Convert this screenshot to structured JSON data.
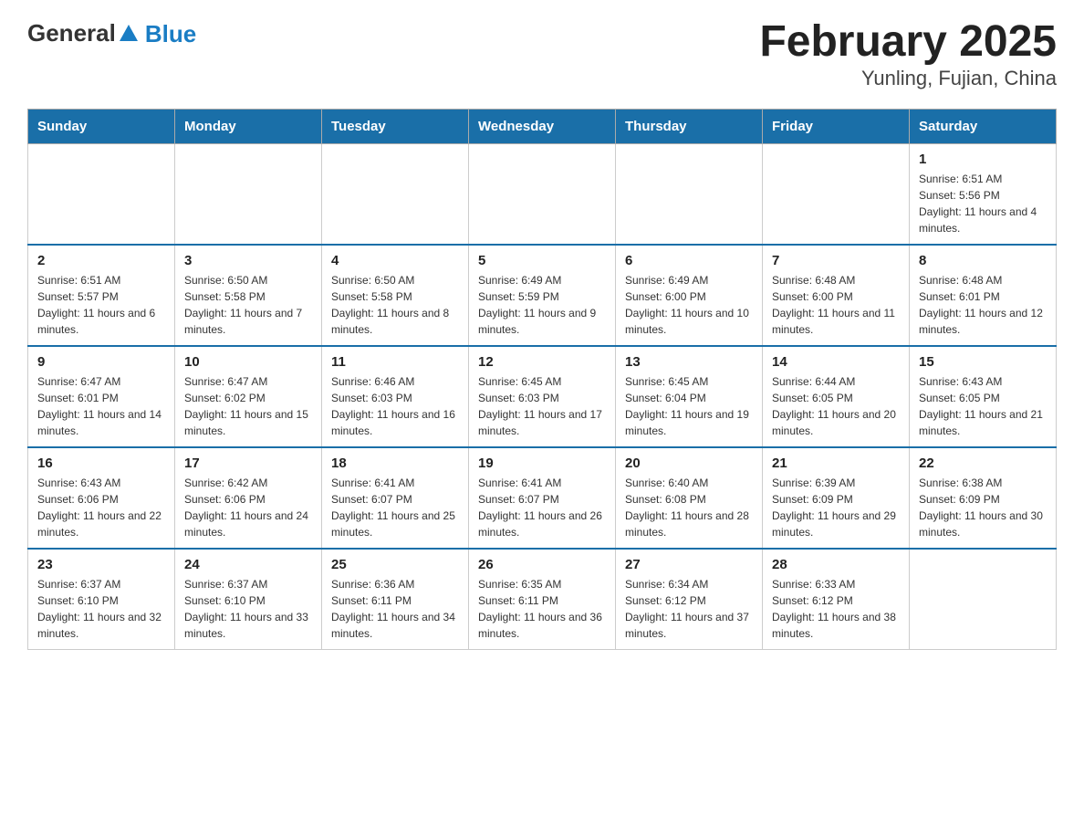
{
  "header": {
    "logo_general": "General",
    "logo_blue": "Blue",
    "title": "February 2025",
    "subtitle": "Yunling, Fujian, China"
  },
  "weekdays": [
    "Sunday",
    "Monday",
    "Tuesday",
    "Wednesday",
    "Thursday",
    "Friday",
    "Saturday"
  ],
  "weeks": [
    [
      {
        "day": "",
        "sunrise": "",
        "sunset": "",
        "daylight": ""
      },
      {
        "day": "",
        "sunrise": "",
        "sunset": "",
        "daylight": ""
      },
      {
        "day": "",
        "sunrise": "",
        "sunset": "",
        "daylight": ""
      },
      {
        "day": "",
        "sunrise": "",
        "sunset": "",
        "daylight": ""
      },
      {
        "day": "",
        "sunrise": "",
        "sunset": "",
        "daylight": ""
      },
      {
        "day": "",
        "sunrise": "",
        "sunset": "",
        "daylight": ""
      },
      {
        "day": "1",
        "sunrise": "Sunrise: 6:51 AM",
        "sunset": "Sunset: 5:56 PM",
        "daylight": "Daylight: 11 hours and 4 minutes."
      }
    ],
    [
      {
        "day": "2",
        "sunrise": "Sunrise: 6:51 AM",
        "sunset": "Sunset: 5:57 PM",
        "daylight": "Daylight: 11 hours and 6 minutes."
      },
      {
        "day": "3",
        "sunrise": "Sunrise: 6:50 AM",
        "sunset": "Sunset: 5:58 PM",
        "daylight": "Daylight: 11 hours and 7 minutes."
      },
      {
        "day": "4",
        "sunrise": "Sunrise: 6:50 AM",
        "sunset": "Sunset: 5:58 PM",
        "daylight": "Daylight: 11 hours and 8 minutes."
      },
      {
        "day": "5",
        "sunrise": "Sunrise: 6:49 AM",
        "sunset": "Sunset: 5:59 PM",
        "daylight": "Daylight: 11 hours and 9 minutes."
      },
      {
        "day": "6",
        "sunrise": "Sunrise: 6:49 AM",
        "sunset": "Sunset: 6:00 PM",
        "daylight": "Daylight: 11 hours and 10 minutes."
      },
      {
        "day": "7",
        "sunrise": "Sunrise: 6:48 AM",
        "sunset": "Sunset: 6:00 PM",
        "daylight": "Daylight: 11 hours and 11 minutes."
      },
      {
        "day": "8",
        "sunrise": "Sunrise: 6:48 AM",
        "sunset": "Sunset: 6:01 PM",
        "daylight": "Daylight: 11 hours and 12 minutes."
      }
    ],
    [
      {
        "day": "9",
        "sunrise": "Sunrise: 6:47 AM",
        "sunset": "Sunset: 6:01 PM",
        "daylight": "Daylight: 11 hours and 14 minutes."
      },
      {
        "day": "10",
        "sunrise": "Sunrise: 6:47 AM",
        "sunset": "Sunset: 6:02 PM",
        "daylight": "Daylight: 11 hours and 15 minutes."
      },
      {
        "day": "11",
        "sunrise": "Sunrise: 6:46 AM",
        "sunset": "Sunset: 6:03 PM",
        "daylight": "Daylight: 11 hours and 16 minutes."
      },
      {
        "day": "12",
        "sunrise": "Sunrise: 6:45 AM",
        "sunset": "Sunset: 6:03 PM",
        "daylight": "Daylight: 11 hours and 17 minutes."
      },
      {
        "day": "13",
        "sunrise": "Sunrise: 6:45 AM",
        "sunset": "Sunset: 6:04 PM",
        "daylight": "Daylight: 11 hours and 19 minutes."
      },
      {
        "day": "14",
        "sunrise": "Sunrise: 6:44 AM",
        "sunset": "Sunset: 6:05 PM",
        "daylight": "Daylight: 11 hours and 20 minutes."
      },
      {
        "day": "15",
        "sunrise": "Sunrise: 6:43 AM",
        "sunset": "Sunset: 6:05 PM",
        "daylight": "Daylight: 11 hours and 21 minutes."
      }
    ],
    [
      {
        "day": "16",
        "sunrise": "Sunrise: 6:43 AM",
        "sunset": "Sunset: 6:06 PM",
        "daylight": "Daylight: 11 hours and 22 minutes."
      },
      {
        "day": "17",
        "sunrise": "Sunrise: 6:42 AM",
        "sunset": "Sunset: 6:06 PM",
        "daylight": "Daylight: 11 hours and 24 minutes."
      },
      {
        "day": "18",
        "sunrise": "Sunrise: 6:41 AM",
        "sunset": "Sunset: 6:07 PM",
        "daylight": "Daylight: 11 hours and 25 minutes."
      },
      {
        "day": "19",
        "sunrise": "Sunrise: 6:41 AM",
        "sunset": "Sunset: 6:07 PM",
        "daylight": "Daylight: 11 hours and 26 minutes."
      },
      {
        "day": "20",
        "sunrise": "Sunrise: 6:40 AM",
        "sunset": "Sunset: 6:08 PM",
        "daylight": "Daylight: 11 hours and 28 minutes."
      },
      {
        "day": "21",
        "sunrise": "Sunrise: 6:39 AM",
        "sunset": "Sunset: 6:09 PM",
        "daylight": "Daylight: 11 hours and 29 minutes."
      },
      {
        "day": "22",
        "sunrise": "Sunrise: 6:38 AM",
        "sunset": "Sunset: 6:09 PM",
        "daylight": "Daylight: 11 hours and 30 minutes."
      }
    ],
    [
      {
        "day": "23",
        "sunrise": "Sunrise: 6:37 AM",
        "sunset": "Sunset: 6:10 PM",
        "daylight": "Daylight: 11 hours and 32 minutes."
      },
      {
        "day": "24",
        "sunrise": "Sunrise: 6:37 AM",
        "sunset": "Sunset: 6:10 PM",
        "daylight": "Daylight: 11 hours and 33 minutes."
      },
      {
        "day": "25",
        "sunrise": "Sunrise: 6:36 AM",
        "sunset": "Sunset: 6:11 PM",
        "daylight": "Daylight: 11 hours and 34 minutes."
      },
      {
        "day": "26",
        "sunrise": "Sunrise: 6:35 AM",
        "sunset": "Sunset: 6:11 PM",
        "daylight": "Daylight: 11 hours and 36 minutes."
      },
      {
        "day": "27",
        "sunrise": "Sunrise: 6:34 AM",
        "sunset": "Sunset: 6:12 PM",
        "daylight": "Daylight: 11 hours and 37 minutes."
      },
      {
        "day": "28",
        "sunrise": "Sunrise: 6:33 AM",
        "sunset": "Sunset: 6:12 PM",
        "daylight": "Daylight: 11 hours and 38 minutes."
      },
      {
        "day": "",
        "sunrise": "",
        "sunset": "",
        "daylight": ""
      }
    ]
  ]
}
